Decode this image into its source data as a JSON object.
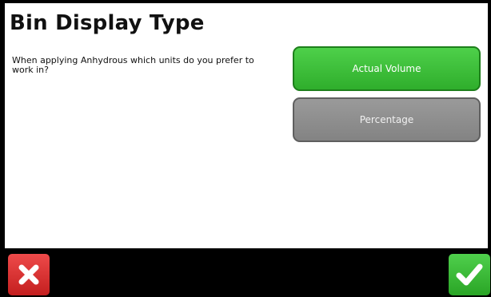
{
  "page": {
    "title": "Bin Display Type",
    "prompt": "When applying Anhydrous which units do you prefer to work in?"
  },
  "options": [
    {
      "label": "Actual Volume",
      "selected": true
    },
    {
      "label": "Percentage",
      "selected": false
    }
  ],
  "footer": {
    "cancel_icon": "close-icon",
    "confirm_icon": "checkmark-icon"
  },
  "colors": {
    "selected_option": "#36b733",
    "unselected_option": "#8d8d8d",
    "cancel_button": "#d83131",
    "confirm_button": "#3bbd37"
  }
}
